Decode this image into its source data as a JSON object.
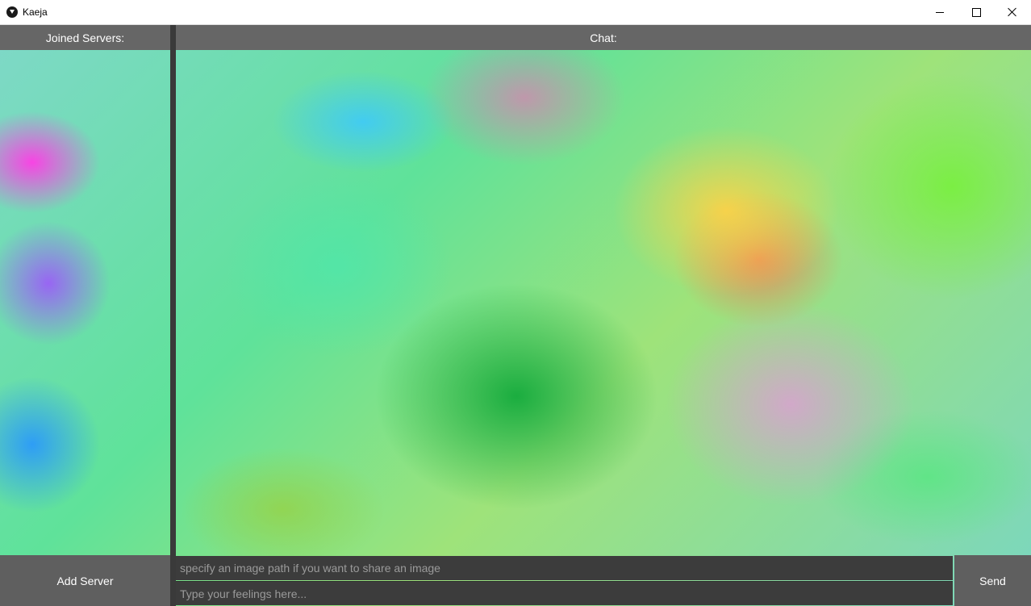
{
  "window": {
    "title": "Kaeja",
    "icon": "kaeja-app-icon",
    "controls": {
      "minimize": "minimize-icon",
      "maximize": "maximize-icon",
      "close": "close-icon"
    }
  },
  "sidebar": {
    "header": "Joined Servers:",
    "add_server_label": "Add Server",
    "servers": []
  },
  "chat": {
    "header": "Chat:",
    "messages": [],
    "image_path_placeholder": "specify an image path if you want to share an image",
    "image_path_value": "",
    "message_placeholder": "Type your feelings here...",
    "message_value": "",
    "send_label": "Send"
  },
  "colors": {
    "header_bg": "#666666",
    "button_bg": "#5f5f5f",
    "input_bg": "#3c3c3c",
    "divider": "#3a3a3a"
  }
}
